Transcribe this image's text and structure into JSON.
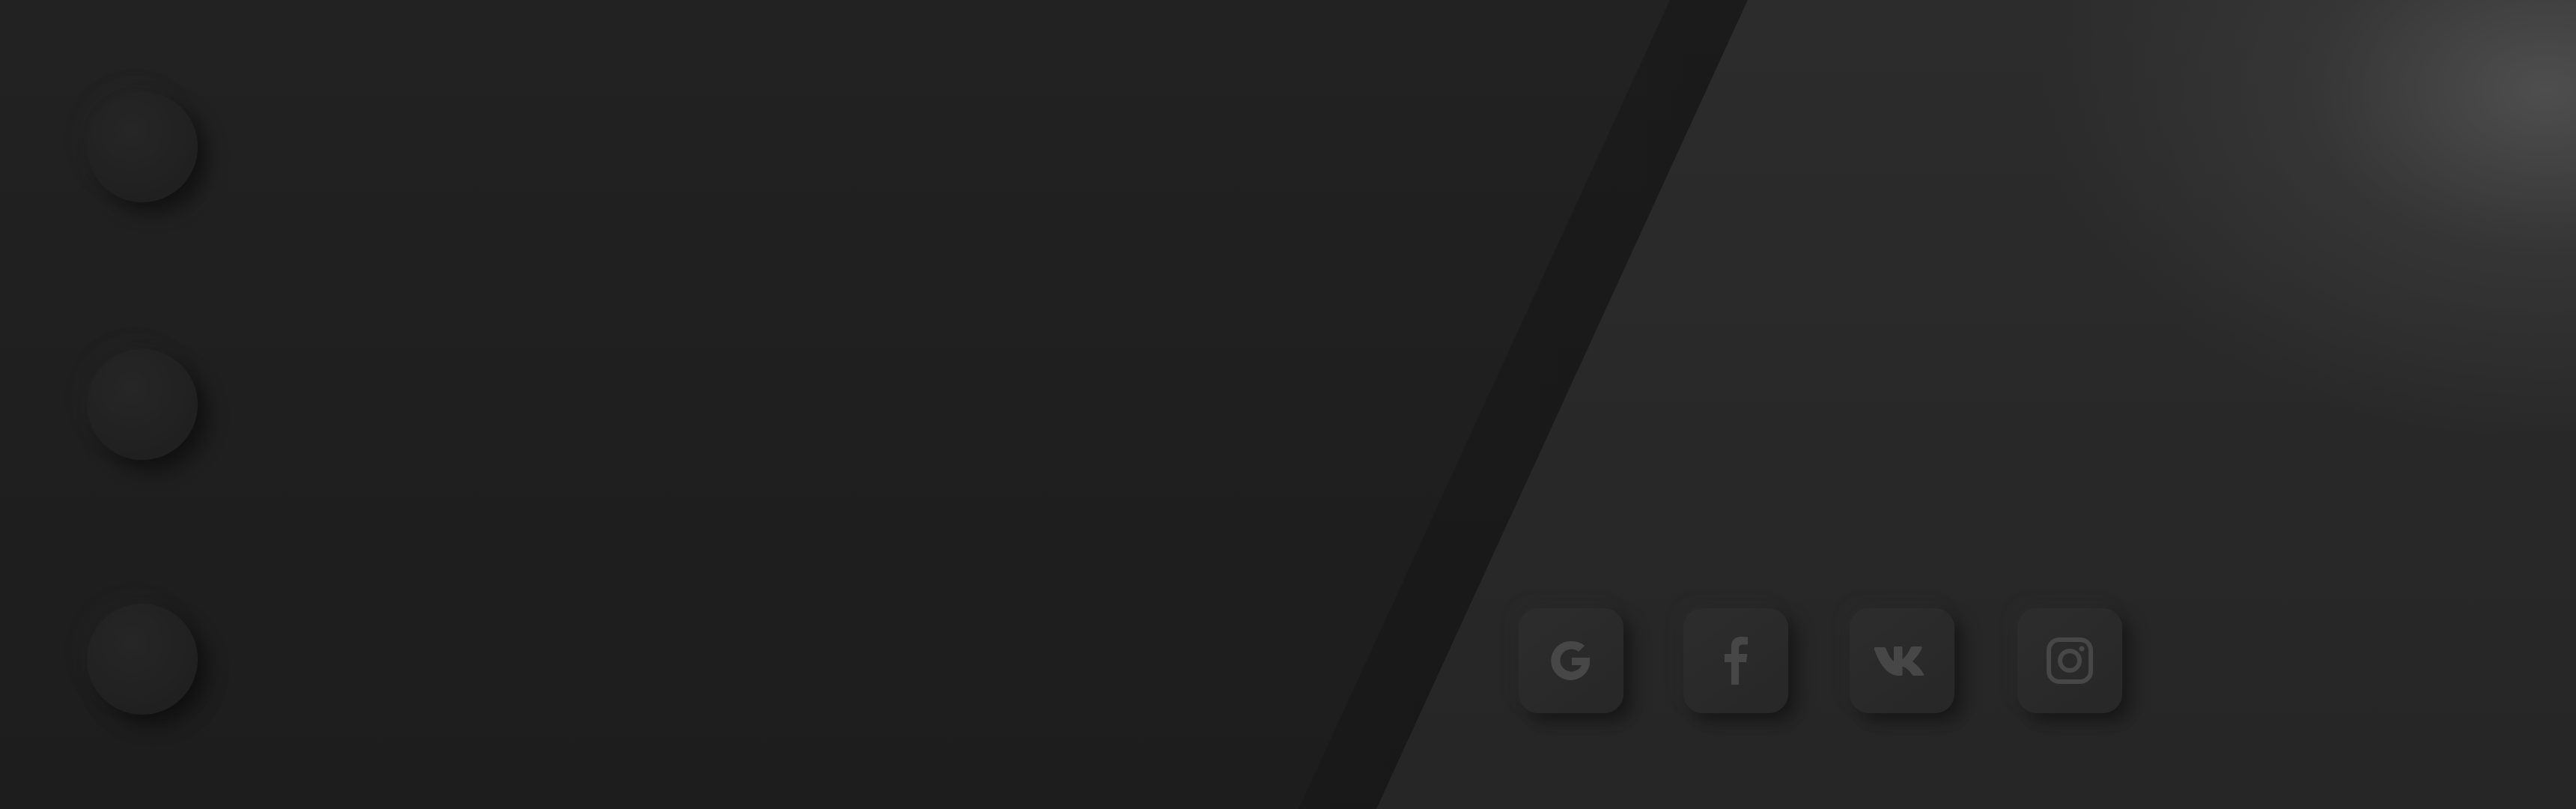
{
  "colors": {
    "background_left": "#1f1f1f",
    "background_right": "#2a2a2a",
    "highlight": "#4a4a4a",
    "icon": "#4a4a4a"
  },
  "left_dots": [
    {
      "name": "dot-1"
    },
    {
      "name": "dot-2"
    },
    {
      "name": "dot-3"
    }
  ],
  "social_buttons": [
    {
      "name": "google-login-button",
      "icon": "google-icon"
    },
    {
      "name": "facebook-login-button",
      "icon": "facebook-icon"
    },
    {
      "name": "vk-login-button",
      "icon": "vk-icon"
    },
    {
      "name": "instagram-login-button",
      "icon": "instagram-icon"
    }
  ]
}
